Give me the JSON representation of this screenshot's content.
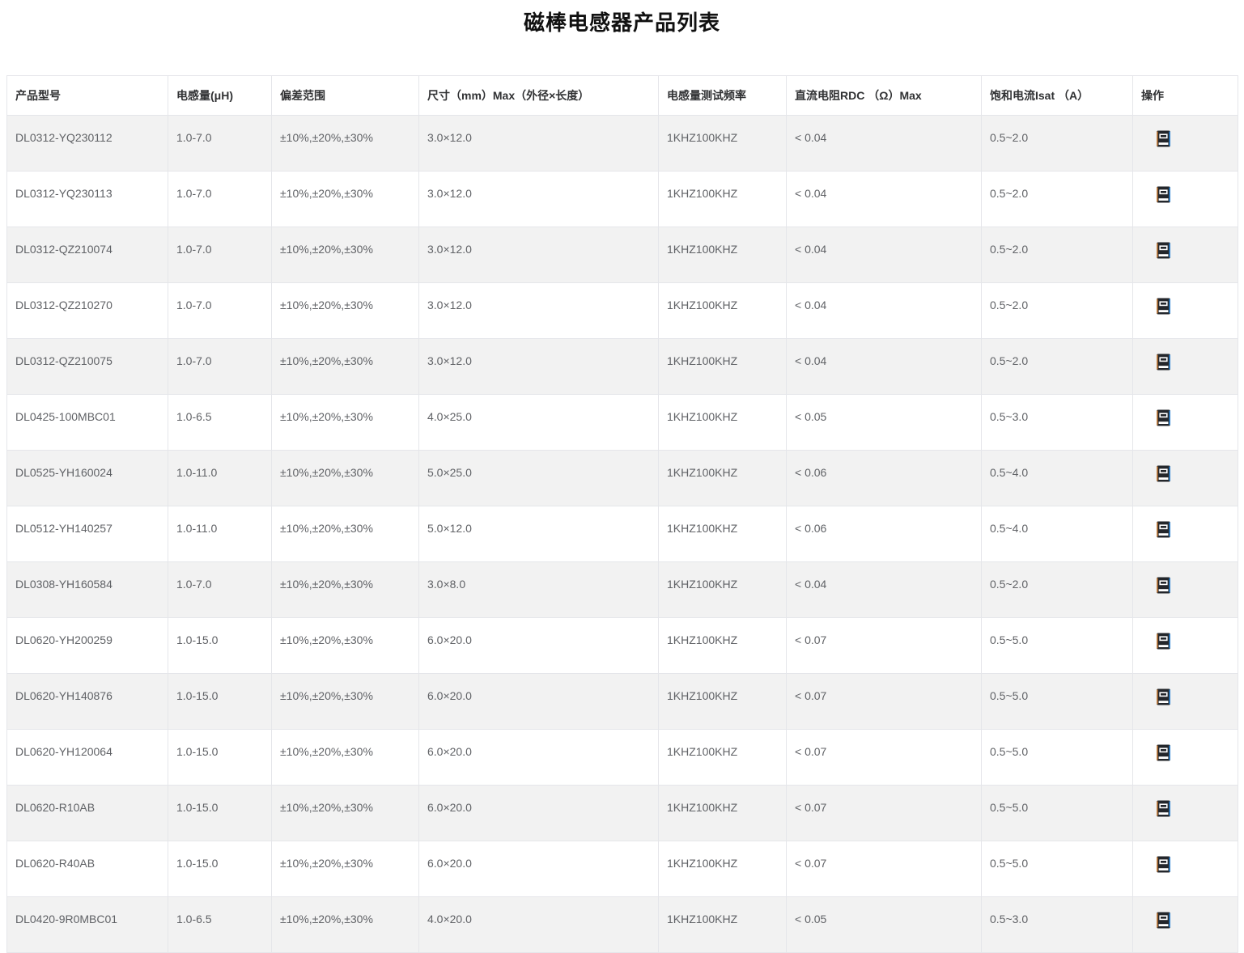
{
  "page": {
    "title": "磁棒电感器产品列表"
  },
  "colors": {
    "row_stripe": "#f2f2f2",
    "table_border": "#e5e6ea",
    "header_text": "#303133",
    "body_text": "#606266",
    "icon_body": "#23262b",
    "icon_spine_left": "#c9803c",
    "icon_edge_right": "#2f86d4",
    "icon_marks": "#ffffff"
  },
  "table": {
    "columns": [
      {
        "key": "model",
        "label": "产品型号"
      },
      {
        "key": "inductance",
        "label": "电感量(μH)"
      },
      {
        "key": "tolerance",
        "label": "偏差范围"
      },
      {
        "key": "size",
        "label": "尺寸（mm）Max（外径×长度）"
      },
      {
        "key": "test_freq",
        "label": "电感量测试频率"
      },
      {
        "key": "rdc",
        "label": "直流电阻RDC （Ω）Max"
      },
      {
        "key": "isat",
        "label": "饱和电流Isat （A）"
      },
      {
        "key": "action",
        "label": "操作"
      }
    ],
    "action_icon": "book-icon",
    "rows": [
      {
        "model": "DL0312-YQ230112",
        "inductance": "1.0-7.0",
        "tolerance": "±10%,±20%,±30%",
        "size": "3.0×12.0",
        "test_freq": "1KHZ100KHZ",
        "rdc": "< 0.04",
        "isat": "0.5~2.0"
      },
      {
        "model": "DL0312-YQ230113",
        "inductance": "1.0-7.0",
        "tolerance": "±10%,±20%,±30%",
        "size": "3.0×12.0",
        "test_freq": "1KHZ100KHZ",
        "rdc": "< 0.04",
        "isat": "0.5~2.0"
      },
      {
        "model": "DL0312-QZ210074",
        "inductance": "1.0-7.0",
        "tolerance": "±10%,±20%,±30%",
        "size": "3.0×12.0",
        "test_freq": "1KHZ100KHZ",
        "rdc": "< 0.04",
        "isat": "0.5~2.0"
      },
      {
        "model": "DL0312-QZ210270",
        "inductance": "1.0-7.0",
        "tolerance": "±10%,±20%,±30%",
        "size": "3.0×12.0",
        "test_freq": "1KHZ100KHZ",
        "rdc": "< 0.04",
        "isat": "0.5~2.0"
      },
      {
        "model": "DL0312-QZ210075",
        "inductance": "1.0-7.0",
        "tolerance": "±10%,±20%,±30%",
        "size": "3.0×12.0",
        "test_freq": "1KHZ100KHZ",
        "rdc": "< 0.04",
        "isat": "0.5~2.0"
      },
      {
        "model": "DL0425-100MBC01",
        "inductance": "1.0-6.5",
        "tolerance": "±10%,±20%,±30%",
        "size": "4.0×25.0",
        "test_freq": "1KHZ100KHZ",
        "rdc": "< 0.05",
        "isat": "0.5~3.0"
      },
      {
        "model": "DL0525-YH160024",
        "inductance": "1.0-11.0",
        "tolerance": "±10%,±20%,±30%",
        "size": "5.0×25.0",
        "test_freq": "1KHZ100KHZ",
        "rdc": "< 0.06",
        "isat": "0.5~4.0"
      },
      {
        "model": "DL0512-YH140257",
        "inductance": "1.0-11.0",
        "tolerance": "±10%,±20%,±30%",
        "size": "5.0×12.0",
        "test_freq": "1KHZ100KHZ",
        "rdc": "< 0.06",
        "isat": "0.5~4.0"
      },
      {
        "model": "DL0308-YH160584",
        "inductance": "1.0-7.0",
        "tolerance": "±10%,±20%,±30%",
        "size": "3.0×8.0",
        "test_freq": "1KHZ100KHZ",
        "rdc": "< 0.04",
        "isat": "0.5~2.0"
      },
      {
        "model": "DL0620-YH200259",
        "inductance": "1.0-15.0",
        "tolerance": "±10%,±20%,±30%",
        "size": "6.0×20.0",
        "test_freq": "1KHZ100KHZ",
        "rdc": "< 0.07",
        "isat": "0.5~5.0"
      },
      {
        "model": "DL0620-YH140876",
        "inductance": "1.0-15.0",
        "tolerance": "±10%,±20%,±30%",
        "size": "6.0×20.0",
        "test_freq": "1KHZ100KHZ",
        "rdc": "< 0.07",
        "isat": "0.5~5.0"
      },
      {
        "model": "DL0620-YH120064",
        "inductance": "1.0-15.0",
        "tolerance": "±10%,±20%,±30%",
        "size": "6.0×20.0",
        "test_freq": "1KHZ100KHZ",
        "rdc": "< 0.07",
        "isat": "0.5~5.0"
      },
      {
        "model": "DL0620-R10AB",
        "inductance": "1.0-15.0",
        "tolerance": "±10%,±20%,±30%",
        "size": "6.0×20.0",
        "test_freq": "1KHZ100KHZ",
        "rdc": "< 0.07",
        "isat": "0.5~5.0"
      },
      {
        "model": "DL0620-R40AB",
        "inductance": "1.0-15.0",
        "tolerance": "±10%,±20%,±30%",
        "size": "6.0×20.0",
        "test_freq": "1KHZ100KHZ",
        "rdc": "< 0.07",
        "isat": "0.5~5.0"
      },
      {
        "model": "DL0420-9R0MBC01",
        "inductance": "1.0-6.5",
        "tolerance": "±10%,±20%,±30%",
        "size": "4.0×20.0",
        "test_freq": "1KHZ100KHZ",
        "rdc": "< 0.05",
        "isat": "0.5~3.0"
      }
    ]
  }
}
